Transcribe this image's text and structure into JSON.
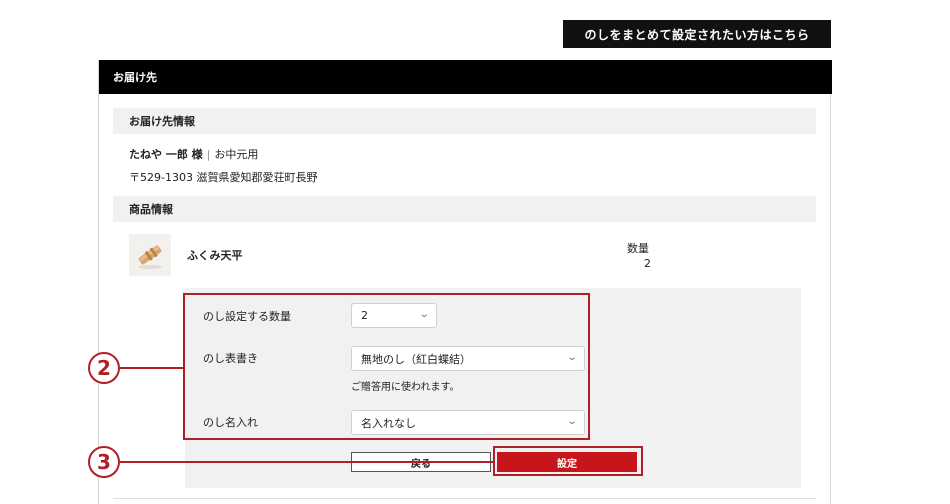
{
  "header": {
    "bulk_noshi_button": "のしをまとめて設定されたい方はこちら"
  },
  "panel": {
    "title": "お届け先"
  },
  "delivery": {
    "section_title": "お届け先情報",
    "recipient_name": "たねや 一郎 様",
    "separator": "|",
    "purpose": "お中元用",
    "address": "〒529-1303 滋賀県愛知郡愛荘町長野"
  },
  "product": {
    "section_title": "商品情報",
    "name": "ふくみ天平",
    "quantity_label": "数量",
    "quantity": "2"
  },
  "noshi_form": {
    "quantity_label": "のし設定する数量",
    "quantity_value": "2",
    "inscription_label": "のし表書き",
    "inscription_value": "無地のし（紅白蝶結）",
    "inscription_note": "ご贈答用に使われます。",
    "name_label": "のし名入れ",
    "name_value": "名入れなし"
  },
  "buttons": {
    "back": "戻る",
    "set": "設定"
  },
  "annotations": {
    "callout_2": "2",
    "callout_3": "3"
  },
  "colors": {
    "accent_red": "#c8151b",
    "annotation_red": "#b01f24",
    "header_black": "#000000",
    "section_gray": "#f1f1f1"
  },
  "icons": {
    "select_chevron": "chevron-down-icon"
  }
}
